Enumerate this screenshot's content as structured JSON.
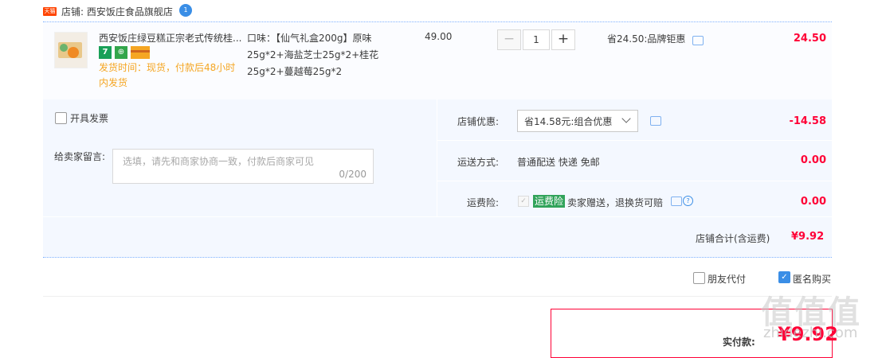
{
  "store": {
    "tag": "天猫",
    "label": "店铺: 西安饭庄食品旗舰店",
    "badge": "1"
  },
  "item": {
    "title": "西安饭庄绿豆糕正宗老式传统桂...",
    "service_icons": [
      "seven-day-return-icon",
      "shield-icon",
      "credit-card-icon"
    ],
    "service_7": "7",
    "service_shield": "⊕",
    "ship_note": "发货时间：现货，付款后48小时内发货",
    "sku": "口味：【仙气礼盒200g】原味25g*2+海盐芝士25g*2+桂花25g*2+蔓越莓25g*2",
    "unit_price": "49.00",
    "quantity": "1",
    "minus": "−",
    "plus": "+",
    "promo": "省24.50:品牌钜惠",
    "total": "24.50"
  },
  "options": {
    "invoice_label": "开具发票",
    "memo_label": "给卖家留言:",
    "memo_placeholder": "选填，请先和商家协商一致，付款后商家可见",
    "memo_count": "0/200",
    "discount_label": "店铺优惠:",
    "discount_selected": "省14.58元:组合优惠",
    "discount_amount": "-14.58",
    "shipping_label": "运送方式:",
    "shipping_method": "普通配送 快递 免邮",
    "shipping_amount": "0.00",
    "insurance_label": "运费险:",
    "insurance_tag": "运费险",
    "insurance_text": "卖家赠送，退换货可赔",
    "insurance_check": "✓",
    "insurance_help": "?",
    "insurance_amount": "0.00"
  },
  "subtotal": {
    "label": "店铺合计(含运费)",
    "value": "¥9.92"
  },
  "bottom": {
    "friend_pay_label": "朋友代付",
    "anonymous_label": "匿名购买",
    "anonymous_check": "✓"
  },
  "pay": {
    "label": "实付款:",
    "value": "¥9.92"
  },
  "watermark": {
    "text": "值值值",
    "sub": "zhidezhi.com"
  },
  "colors": {
    "accent_red": "#ff0036",
    "brand_blue": "#3a8ee6",
    "warn_orange": "#f5a623",
    "panel_bg": "#f4f8ff"
  }
}
